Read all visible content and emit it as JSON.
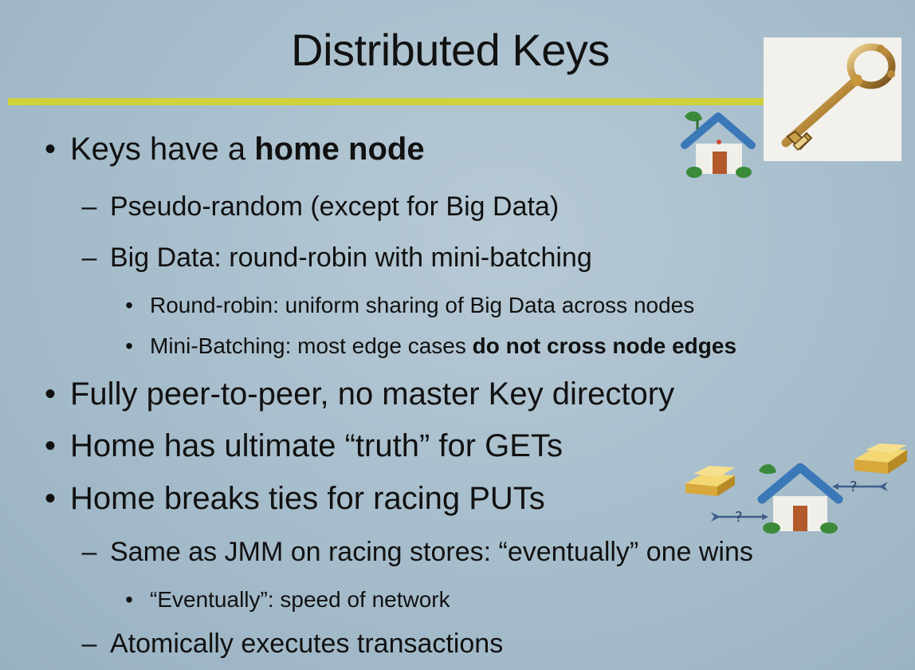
{
  "slide": {
    "title": "Distributed Keys"
  },
  "bullets": {
    "home_node_prefix": "Keys have a ",
    "home_node_bold": "home node",
    "pseudo_random": "Pseudo-random (except for Big Data)",
    "big_data": "Big Data: round-robin with mini-batching",
    "round_robin": "Round-robin: uniform sharing of Big Data across nodes",
    "mini_batching_prefix": "Mini-Batching: most edge cases ",
    "mini_batching_bold": "do not cross node edges",
    "peer_to_peer": "Fully peer-to-peer, no master Key directory",
    "home_truth": "Home has ultimate “truth” for GETs",
    "home_ties": "Home breaks ties for racing PUTs",
    "jmm": "Same as JMM on racing stores: “eventually” one wins",
    "eventually": "“Eventually”: speed of network",
    "atomic": "Atomically executes transactions"
  },
  "markers": {
    "level1": "•",
    "level2": "–",
    "level3": "•"
  },
  "diagram": {
    "question_mark": "?"
  },
  "colors": {
    "background": "#a9bfcd",
    "title_rule": "#cfd23a",
    "roof": "#3a78b8",
    "door": "#b25a2a",
    "gold": "#e3b83a",
    "arrow": "#3f5f8a"
  },
  "icons": {
    "key": "antique-key-icon",
    "house": "house-icon",
    "gold": "gold-bars-icon"
  }
}
